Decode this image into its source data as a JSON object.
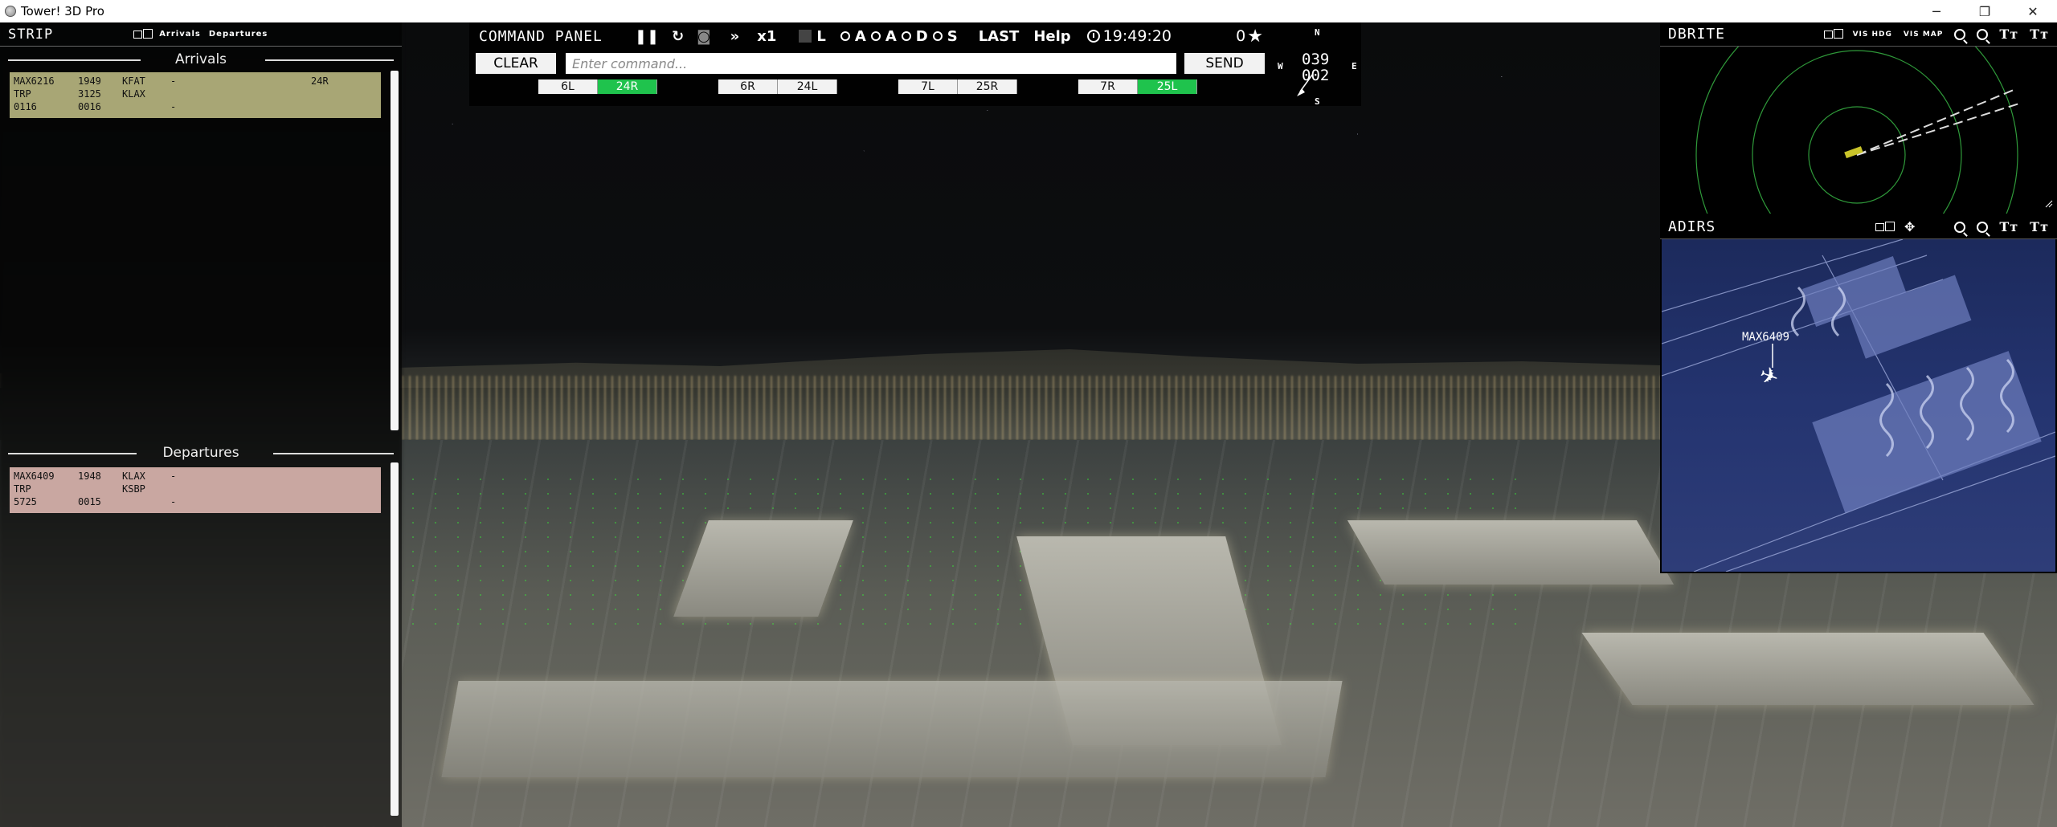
{
  "window": {
    "title": "Tower! 3D Pro",
    "controls": [
      "─",
      "❐",
      "✕"
    ]
  },
  "strip": {
    "title": "STRIP",
    "tab_arrivals": "Arrivals",
    "tab_departures": "Departures",
    "arrivals_heading": "Arrivals",
    "departures_heading": "Departures",
    "arrivals": [
      {
        "callsign": "MAX6216",
        "time": "1949",
        "origin": "KFAT",
        "mark": "-",
        "runway": "24R",
        "type": "TRP",
        "altitude": "3125",
        "dest": "KLAX",
        "squawk": "0116",
        "code": "0016",
        "mark2": "-"
      }
    ],
    "departures": [
      {
        "callsign": "MAX6409",
        "time": "1948",
        "origin": "KLAX",
        "mark": "-",
        "type": "TRP",
        "dest": "KSBP",
        "squawk": "5725",
        "code": "0015",
        "mark2": "-"
      }
    ]
  },
  "command_panel": {
    "title": "COMMAND PANEL",
    "icons": [
      "pause-icon",
      "restart-icon",
      "camera-icon",
      "fast-forward-icon"
    ],
    "speed": "x1",
    "toggles": [
      "L",
      "A",
      "A",
      "D",
      "S"
    ],
    "last_label": "LAST",
    "help_label": "Help",
    "time": "19:49:20",
    "score": "0",
    "clear_label": "CLEAR",
    "input_placeholder": "Enter command...",
    "send_label": "SEND",
    "runways": [
      [
        {
          "label": "6L",
          "active": false
        },
        {
          "label": "24R",
          "active": true
        }
      ],
      [
        {
          "label": "6R",
          "active": false
        },
        {
          "label": "24L",
          "active": false
        }
      ],
      [
        {
          "label": "7L",
          "active": false
        },
        {
          "label": "25R",
          "active": false
        }
      ],
      [
        {
          "label": "7R",
          "active": false
        },
        {
          "label": "25L",
          "active": true
        }
      ]
    ]
  },
  "compass": {
    "n": "N",
    "s": "S",
    "w": "W",
    "e": "E",
    "heading": "039",
    "wind": "002"
  },
  "dbrite": {
    "title": "DBRITE",
    "vis_hdg": "VIS HDG",
    "vis_map": "VIS MAP"
  },
  "adirs": {
    "title": "ADIRS",
    "aircraft_label": "MAX6409"
  },
  "colors": {
    "arrival_strip": "#a8a675",
    "departure_strip": "#c9a7a1",
    "runway_active": "#1fc34d",
    "radar_ring": "#2f9a3a"
  }
}
